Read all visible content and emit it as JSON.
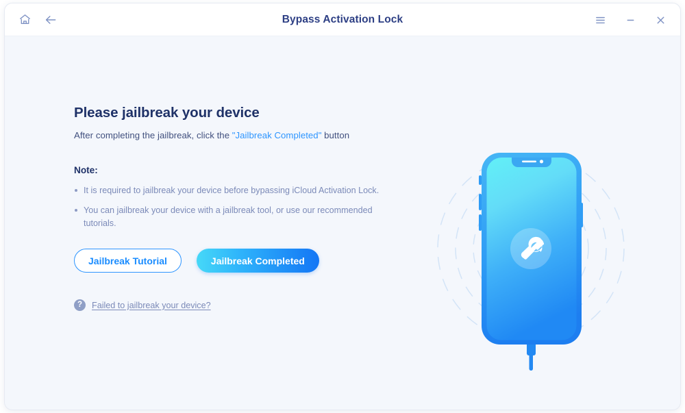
{
  "window": {
    "title": "Bypass Activation Lock",
    "controls": {
      "home": "home-icon",
      "back": "back-arrow-icon",
      "menu": "hamburger-menu-icon",
      "minimize": "minimize-icon",
      "close": "close-icon"
    }
  },
  "main": {
    "heading": "Please jailbreak your device",
    "subheading_before": "After completing the jailbreak, click the ",
    "subheading_highlight": "\"Jailbreak Completed\"",
    "subheading_after": " button",
    "note_title": "Note:",
    "notes": [
      "It is required to jailbreak your device before bypassing iCloud Activation Lock.",
      "You can jailbreak your device with a jailbreak tool, or use our recommended tutorials."
    ],
    "buttons": {
      "tutorial": "Jailbreak Tutorial",
      "completed": "Jailbreak Completed"
    },
    "help": {
      "icon": "question-mark-icon",
      "link": "Failed to jailbreak your device?"
    }
  },
  "illustration": {
    "name": "phone-with-wrench-illustration",
    "screen_icon": "wrench-icon",
    "accent_cyan": "#5de3f7",
    "accent_blue": "#1a82f0",
    "ring_color": "#d8e6f8"
  }
}
